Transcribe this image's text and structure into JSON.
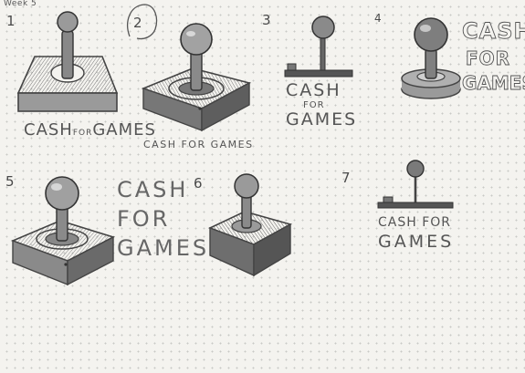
{
  "page": {
    "heading": "Week 5"
  },
  "sketches": [
    {
      "number": "1",
      "brand_lines": [
        "CASH",
        "FOR",
        "GAMES"
      ]
    },
    {
      "number": "2",
      "brand_lines": [
        "CASH FOR GAMES"
      ]
    },
    {
      "number": "3",
      "brand_lines": [
        "CASH",
        "FOR",
        "GAMES"
      ]
    },
    {
      "number": "4",
      "brand_lines": [
        "CASH",
        "FOR",
        "GAMES"
      ]
    },
    {
      "number": "5",
      "brand_lines": [
        "CASH",
        "FOR",
        "GAMES"
      ]
    },
    {
      "number": "6",
      "brand_lines": []
    },
    {
      "number": "7",
      "brand_lines": [
        "CASH FOR",
        "GAMES"
      ]
    }
  ],
  "colors": {
    "paper": "#f4f3ef",
    "graphite": "#555555",
    "dots": "#c9c9c6"
  }
}
